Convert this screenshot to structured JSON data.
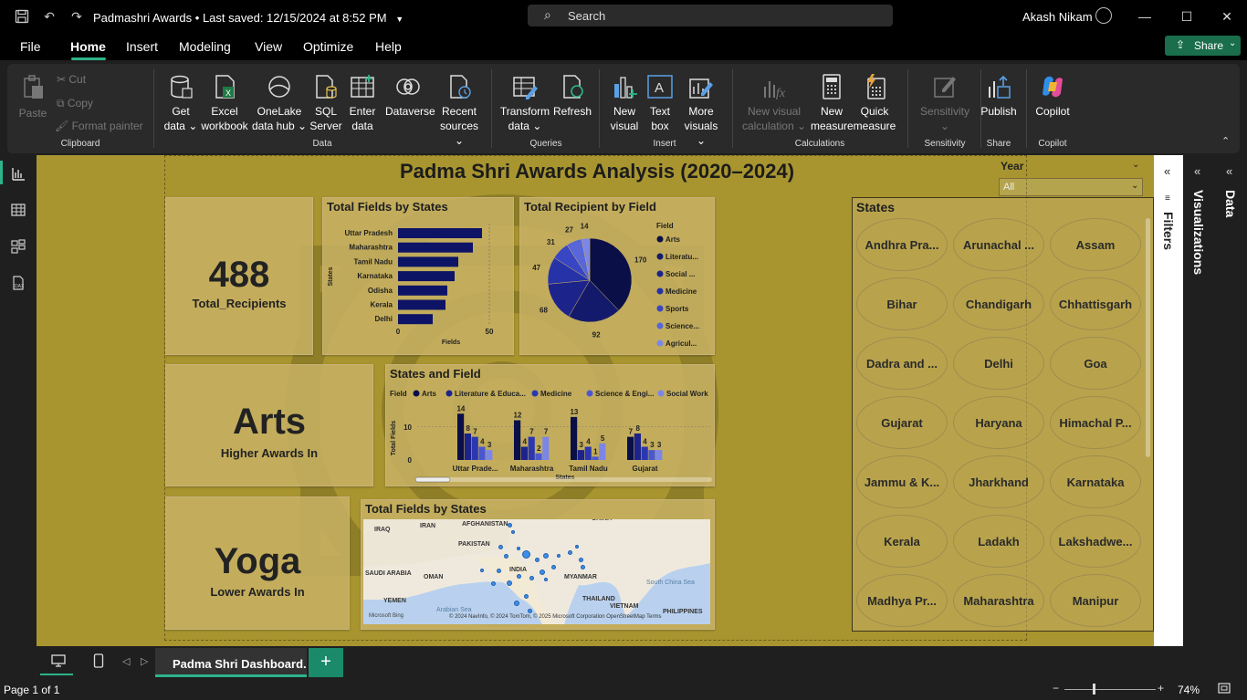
{
  "window": {
    "title": "Padmashri Awards",
    "saved_status": "• Last saved: 12/15/2024 at 8:52 PM",
    "search_label": "Search",
    "user_name": "Akash Nikam"
  },
  "menu": [
    "File",
    "Home",
    "Insert",
    "Modeling",
    "View",
    "Optimize",
    "Help"
  ],
  "share_label": "Share",
  "ribbon": {
    "clipboard": {
      "paste": "Paste",
      "cut": "Cut",
      "copy": "Copy",
      "format_painter": "Format painter",
      "group": "Clipboard"
    },
    "data": {
      "get_data": [
        "Get",
        "data"
      ],
      "excel": [
        "Excel",
        "workbook"
      ],
      "onelake": [
        "OneLake",
        "data hub"
      ],
      "sql": [
        "SQL",
        "Server"
      ],
      "enter": [
        "Enter",
        "data"
      ],
      "dataverse": "Dataverse",
      "recent": [
        "Recent",
        "sources"
      ],
      "group": "Data"
    },
    "queries": {
      "transform": [
        "Transform",
        "data"
      ],
      "refresh": "Refresh",
      "group": "Queries"
    },
    "insert": {
      "new_visual": [
        "New",
        "visual"
      ],
      "text_box": [
        "Text",
        "box"
      ],
      "more_visuals": [
        "More",
        "visuals"
      ],
      "group": "Insert"
    },
    "calculations": {
      "new_visual_calc": [
        "New visual",
        "calculation"
      ],
      "new_measure": [
        "New",
        "measure"
      ],
      "quick_measure": [
        "Quick",
        "measure"
      ],
      "group": "Calculations"
    },
    "sensitivity": {
      "label": "Sensitivity",
      "group": "Sensitivity"
    },
    "share": {
      "publish": "Publish",
      "group": "Share"
    },
    "copilot": {
      "label": "Copilot",
      "group": "Copilot"
    }
  },
  "report": {
    "title": "Padma Shri Awards Analysis (2020–2024)",
    "kpi_total": {
      "value": "488",
      "label": "Total_Recipients"
    },
    "kpi_higher": {
      "value": "Arts",
      "label": "Higher Awards In"
    },
    "kpi_lower": {
      "value": "Yoga",
      "label": "Lower Awards In"
    },
    "year_slicer": {
      "label": "Year",
      "value": "All"
    },
    "states_slicer": {
      "title": "States",
      "items": [
        "Andhra Pra...",
        "Arunachal ...",
        "Assam",
        "Bihar",
        "Chandigarh",
        "Chhattisgarh",
        "Dadra and ...",
        "Delhi",
        "Goa",
        "Gujarat",
        "Haryana",
        "Himachal P...",
        "Jammu & K...",
        "Jharkhand",
        "Karnataka",
        "Kerala",
        "Ladakh",
        "Lakshadwe...",
        "Madhya Pr...",
        "Maharashtra",
        "Manipur"
      ]
    },
    "map": {
      "title": "Total Fields by States",
      "labels": [
        "IRAQ",
        "IRAN",
        "AFGHANISTAN",
        "PAKISTAN",
        "CHINA",
        "SAUDI ARABIA",
        "OMAN",
        "INDIA",
        "MYANMAR",
        "YEMEN",
        "Arabian Sea",
        "THAILAND",
        "South China Sea",
        "VIETNAM",
        "PHILIPPINES"
      ],
      "attribution": "© 2024 NavInfo, © 2024 TomTom, © 2025 Microsoft Corporation  OpenStreetMap  Terms",
      "logo": "Microsoft Bing"
    }
  },
  "chart_data": [
    {
      "type": "bar",
      "orientation": "horizontal",
      "title": "Total Fields by States",
      "xlabel": "Fields",
      "ylabel": "States",
      "categories": [
        "Uttar Pradesh",
        "Maharashtra",
        "Tamil Nadu",
        "Karnataka",
        "Odisha",
        "Kerala",
        "Delhi"
      ],
      "values": [
        46,
        41,
        33,
        31,
        27,
        26,
        19
      ],
      "xlim": [
        0,
        50
      ],
      "ticks": [
        "0",
        "50"
      ],
      "color": "#0d1466"
    },
    {
      "type": "pie",
      "title": "Total Recipient by Field",
      "legend_title": "Field",
      "legend_placement": "right",
      "labels": [
        "Arts",
        "Literatu...",
        "Social ...",
        "Medicine",
        "Sports",
        "Science...",
        "Agricul..."
      ],
      "values": [
        170,
        92,
        68,
        47,
        31,
        27,
        14
      ],
      "colors": [
        "#0a0f47",
        "#141a6b",
        "#1c238a",
        "#2632a8",
        "#3846c4",
        "#5766d8",
        "#7b86e6"
      ]
    },
    {
      "type": "bar",
      "title": "States and Field",
      "legend_title": "Field",
      "legend_placement": "top",
      "xlabel": "States",
      "ylabel": "Total Fields",
      "categories": [
        "Uttar Prade...",
        "Maharashtra",
        "Tamil Nadu",
        "Gujarat"
      ],
      "ticks": [
        "0",
        "10"
      ],
      "series": [
        {
          "name": "Arts",
          "values": [
            14,
            12,
            13,
            7
          ],
          "color": "#0a0f47"
        },
        {
          "name": "Literature & Educa...",
          "values": [
            8,
            4,
            3,
            8
          ],
          "color": "#1c238a"
        },
        {
          "name": "Medicine",
          "values": [
            7,
            7,
            4,
            4
          ],
          "color": "#2b37b0"
        },
        {
          "name": "Science & Engi...",
          "values": [
            4,
            2,
            1,
            3
          ],
          "color": "#4a58d0"
        },
        {
          "name": "Social Work",
          "values": [
            3,
            7,
            5,
            3
          ],
          "color": "#7b86e6"
        }
      ]
    }
  ],
  "left_rail": [
    "report-view-icon",
    "table-view-icon",
    "model-view-icon",
    "dax-query-icon"
  ],
  "panes": {
    "filters": "Filters",
    "visualizations": "Visualizations",
    "data": "Data"
  },
  "page_tab": "Padma Shri Dashboard.",
  "status": {
    "page": "Page 1 of 1",
    "zoom": "74%"
  }
}
